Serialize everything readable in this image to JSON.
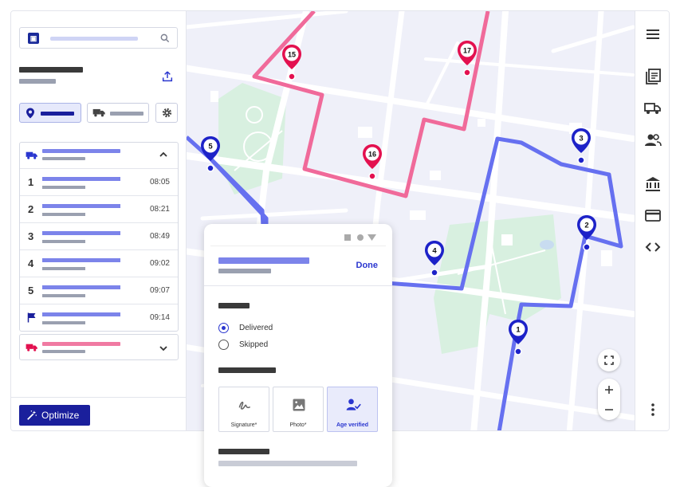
{
  "sidebar": {
    "optimize_label": "Optimize"
  },
  "route_stops": [
    {
      "num": "1",
      "time": "08:05"
    },
    {
      "num": "2",
      "time": "08:21"
    },
    {
      "num": "3",
      "time": "08:49"
    },
    {
      "num": "4",
      "time": "09:02"
    },
    {
      "num": "5",
      "time": "09:07"
    }
  ],
  "route_end_time": "09:14",
  "map": {
    "blue_markers": [
      "5",
      "3",
      "2",
      "4",
      "1"
    ],
    "pink_markers": [
      "15",
      "17",
      "16"
    ],
    "colors": {
      "blue_route": "#6670f0",
      "pink_route": "#f06a9a",
      "blue_marker": "#1d22c8",
      "pink_marker": "#e3104f",
      "park": "#d8f0e0"
    }
  },
  "phone": {
    "done_label": "Done",
    "status_options": [
      {
        "label": "Delivered",
        "selected": true
      },
      {
        "label": "Skipped",
        "selected": false
      }
    ],
    "proof_options": [
      {
        "label": "Signature*",
        "icon": "signature-icon",
        "selected": false
      },
      {
        "label": "Photo*",
        "icon": "photo-icon",
        "selected": false
      },
      {
        "label": "Age verified",
        "icon": "age-verified-icon",
        "selected": true
      }
    ]
  }
}
